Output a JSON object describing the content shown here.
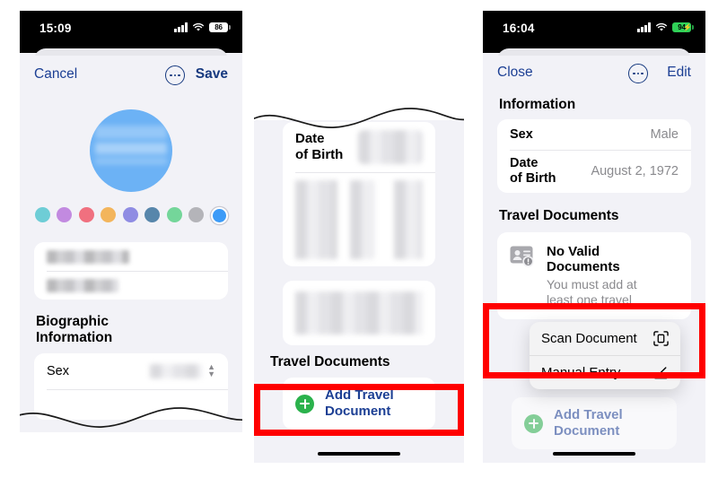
{
  "panels": [
    {
      "id": "edit-contact",
      "statusbar": {
        "time": "15:09",
        "battery": "86",
        "charging": false
      },
      "nav": {
        "left": "Cancel",
        "right": "Save",
        "menu_icon": "ellipsis-circle-icon"
      },
      "avatar": {
        "icon": "contact-avatar",
        "color": "#6cb2f5"
      },
      "swatches": [
        {
          "name": "teal",
          "color": "#6ecdd6"
        },
        {
          "name": "purple",
          "color": "#c28ae0"
        },
        {
          "name": "pink",
          "color": "#f0707f"
        },
        {
          "name": "orange",
          "color": "#f3b55c"
        },
        {
          "name": "periwinkle",
          "color": "#8f8ce3"
        },
        {
          "name": "steel-blue",
          "color": "#5786ab"
        },
        {
          "name": "green",
          "color": "#74d69a"
        },
        {
          "name": "gray",
          "color": "#b4b4b9"
        },
        {
          "name": "blue",
          "color": "#3d9bf7",
          "selected": true
        }
      ],
      "name_fields": [
        {
          "name": "first-name-field",
          "redacted": true
        },
        {
          "name": "last-name-field",
          "redacted": true
        }
      ],
      "section_heading": "Biographic\nInformation",
      "rows": [
        {
          "label": "Sex",
          "value": "",
          "redacted": true,
          "stepper": true
        }
      ]
    },
    {
      "id": "contact-scroll",
      "rows": [
        {
          "label": "Date\nof Birth",
          "value": "",
          "redacted": true
        }
      ],
      "travel_heading": "Travel Documents",
      "add_button": {
        "label": "Add Travel\nDocument",
        "icon": "plus-circle-icon",
        "highlighted": true
      }
    },
    {
      "id": "contact-detail",
      "statusbar": {
        "time": "16:04",
        "battery": "94",
        "charging": true
      },
      "nav": {
        "left": "Close",
        "right": "Edit",
        "menu_icon": "ellipsis-circle-icon"
      },
      "section_heading": "Information",
      "rows": [
        {
          "label": "Sex",
          "value": "Male"
        },
        {
          "label": "Date\nof Birth",
          "value": "August 2, 1972"
        }
      ],
      "travel_heading": "Travel Documents",
      "warning": {
        "icon": "id-card-warning-icon",
        "title": "No Valid\nDocuments",
        "subtitle": "You must add at\nleast one travel"
      },
      "context_menu": {
        "highlighted": true,
        "items": [
          {
            "label": "Scan Document",
            "icon": "document-scan-icon"
          },
          {
            "label": "Manual Entry",
            "icon": "pencil-icon"
          }
        ]
      },
      "add_button": {
        "label": "Add Travel\nDocument",
        "icon": "plus-circle-icon",
        "dimmed": true
      }
    }
  ],
  "colors": {
    "highlight": "#ff0000",
    "link": "#1c3f94",
    "green": "#2bb24c",
    "background": "#f2f2f7"
  }
}
